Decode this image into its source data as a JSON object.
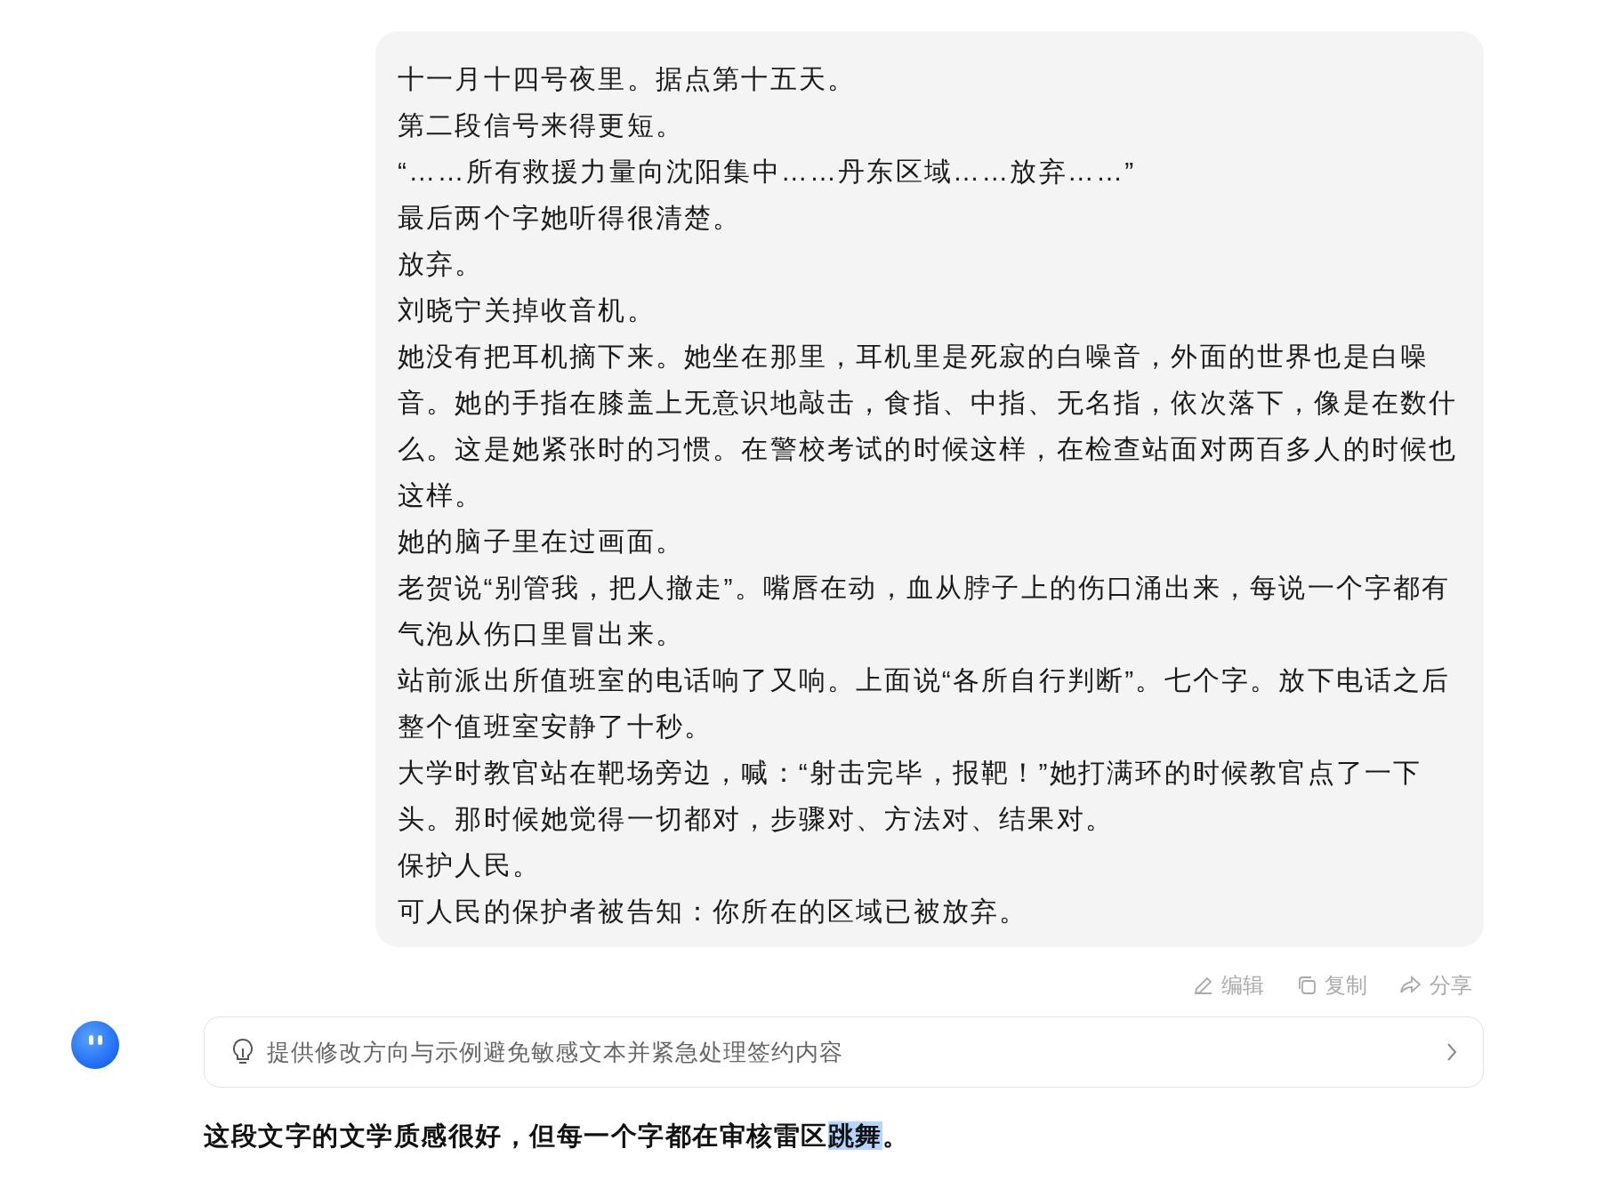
{
  "user_message": {
    "paragraphs": [
      "十一月十四号夜里。据点第十五天。",
      "第二段信号来得更短。",
      "“……所有救援力量向沈阳集中……丹东区域……放弃……”",
      "最后两个字她听得很清楚。",
      "放弃。",
      "刘晓宁关掉收音机。",
      "她没有把耳机摘下来。她坐在那里，耳机里是死寂的白噪音，外面的世界也是白噪音。她的手指在膝盖上无意识地敲击，食指、中指、无名指，依次落下，像是在数什么。这是她紧张时的习惯。在警校考试的时候这样，在检查站面对两百多人的时候也这样。",
      "她的脑子里在过画面。",
      "老贺说“别管我，把人撤走”。嘴唇在动，血从脖子上的伤口涌出来，每说一个字都有气泡从伤口里冒出来。",
      "站前派出所值班室的电话响了又响。上面说“各所自行判断”。七个字。放下电话之后整个值班室安静了十秒。",
      "大学时教官站在靶场旁边，喊：“射击完毕，报靶！”她打满环的时候教官点了一下头。那时候她觉得一切都对，步骤对、方法对、结果对。",
      "保护人民。",
      "可人民的保护者被告知：你所在的区域已被放弃。"
    ]
  },
  "message_actions": [
    {
      "kind": "edit",
      "label": "编辑"
    },
    {
      "kind": "copy",
      "label": "复制"
    },
    {
      "kind": "share",
      "label": "分享"
    }
  ],
  "suggestion": {
    "text": "提供修改方向与示例避免敏感文本并紧急处理签约内容"
  },
  "reply": {
    "text_before": "这段文字的文学质感很好，但每一个字都在审核雷区",
    "selected_text": "跳舞",
    "text_after": "。"
  }
}
